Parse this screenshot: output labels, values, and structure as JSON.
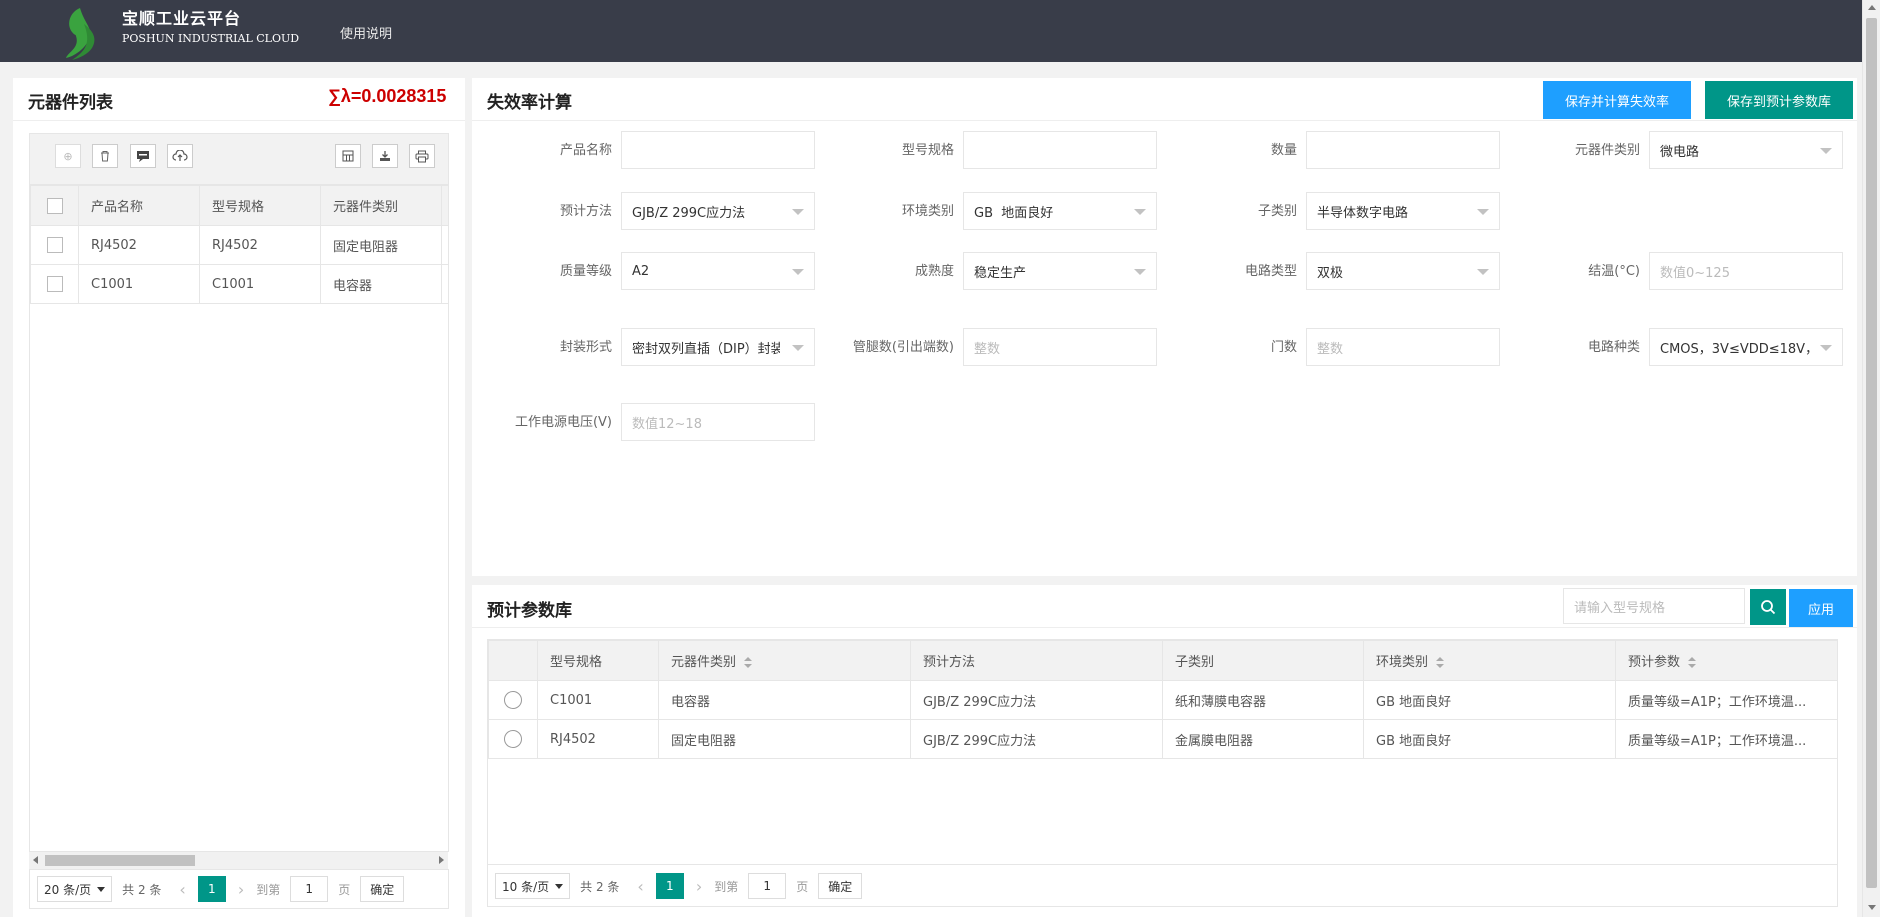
{
  "header": {
    "brand_cn": "宝顺工业云平台",
    "brand_en": "POSHUN INDUSTRIAL CLOUD",
    "nav_help": "使用说明",
    "logo_color": "#3aa33f"
  },
  "left_panel": {
    "title": "元器件列表",
    "sigma": "∑λ=0.0028315",
    "toolbar": [
      "add-icon",
      "delete-icon",
      "comment-icon",
      "upload-icon",
      "columns-icon",
      "export-icon",
      "print-icon"
    ],
    "columns": [
      "产品名称",
      "型号规格",
      "元器件类别"
    ],
    "rows": [
      {
        "name": "RJ4502",
        "model": "RJ4502",
        "category": "固定电阻器"
      },
      {
        "name": "C1001",
        "model": "C1001",
        "category": "电容器"
      }
    ],
    "pager": {
      "per_page": "20 条/页",
      "total": "共 2 条",
      "current": "1",
      "goto": "到第",
      "page_input": "1",
      "page_unit": "页",
      "confirm": "确定"
    }
  },
  "calc_panel": {
    "title": "失效率计算",
    "btn_save_calc": "保存并计算失效率",
    "btn_save_lib": "保存到预计参数库",
    "fields": {
      "product_name": {
        "label": "产品名称",
        "value": ""
      },
      "model": {
        "label": "型号规格",
        "value": ""
      },
      "quantity": {
        "label": "数量",
        "value": ""
      },
      "category": {
        "label": "元器件类别",
        "value": "微电路"
      },
      "method": {
        "label": "预计方法",
        "value": "GJB/Z 299C应力法"
      },
      "environment": {
        "label": "环境类别",
        "value": "GB  地面良好"
      },
      "subcategory": {
        "label": "子类别",
        "value": "半导体数字电路"
      },
      "quality": {
        "label": "质量等级",
        "value": "A2"
      },
      "maturity": {
        "label": "成熟度",
        "value": "稳定生产"
      },
      "circuit_type": {
        "label": "电路类型",
        "value": "双极"
      },
      "junction_temp": {
        "label": "结温(°C)",
        "placeholder": "数值0~125"
      },
      "package": {
        "label": "封装形式",
        "value": "密封双列直插（DIP）封装"
      },
      "pins": {
        "label": "管腿数(引出端数)",
        "placeholder": "整数"
      },
      "gates": {
        "label": "门数",
        "placeholder": "整数"
      },
      "circuit_kind": {
        "label": "电路种类",
        "value": "CMOS，3V≤VDD≤18V，"
      },
      "voltage": {
        "label": "工作电源电压(V)",
        "placeholder": "数值12~18"
      }
    }
  },
  "lib_panel": {
    "title": "预计参数库",
    "search_placeholder": "请输入型号规格",
    "apply": "应用",
    "columns": [
      "型号规格",
      "元器件类别",
      "预计方法",
      "子类别",
      "环境类别",
      "预计参数"
    ],
    "rows": [
      {
        "model": "C1001",
        "category": "电容器",
        "method": "GJB/Z 299C应力法",
        "sub": "纸和薄膜电容器",
        "env": "GB 地面良好",
        "params": "质量等级=A1P；工作环境温..."
      },
      {
        "model": "RJ4502",
        "category": "固定电阻器",
        "method": "GJB/Z 299C应力法",
        "sub": "金属膜电阻器",
        "env": "GB 地面良好",
        "params": "质量等级=A1P；工作环境温..."
      }
    ],
    "pager": {
      "per_page": "10 条/页",
      "total": "共 2 条",
      "current": "1",
      "goto": "到第",
      "page_input": "1",
      "page_unit": "页",
      "confirm": "确定"
    }
  },
  "colors": {
    "topbar": "#393d49",
    "teal": "#009688",
    "blue": "#1e9fff",
    "sigma": "#cc0000"
  }
}
